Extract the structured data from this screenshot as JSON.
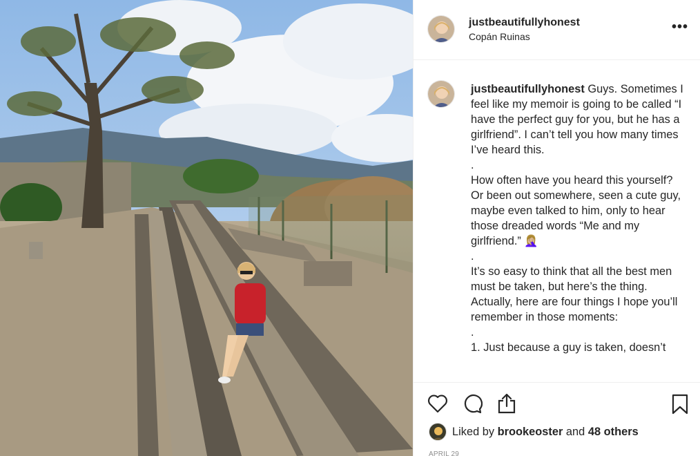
{
  "post": {
    "username": "justbeautifullyhonest",
    "location": "Copán Ruinas",
    "more_label": "•••"
  },
  "caption": {
    "username": "justbeautifullyhonest",
    "text": " Guys. Sometimes I feel like my memoir is going to be called “I have the perfect guy for you, but he has a girlfriend”. I can’t tell you how many times I’ve heard this.\n.\nHow often have you heard this yourself? Or been out somewhere, seen a cute guy, maybe even talked to him, only to hear those dreaded words “Me and my girlfriend.” 🤦🏼‍♀️\n.\nIt’s so easy to think that all the best men must be taken, but here’s the thing. Actually, here are four things I hope you’ll remember in those moments:\n.\n1. Just because a guy is taken, doesn’t"
  },
  "likes": {
    "prefix": "Liked by",
    "user": "brookeoster",
    "middle": "and",
    "others": "48 others"
  },
  "date": "APRIL 29",
  "icons": {
    "like": "heart-icon",
    "comment": "comment-icon",
    "share": "share-icon",
    "save": "bookmark-icon",
    "more": "more-options-icon"
  },
  "colors": {
    "text": "#262626",
    "secondary": "#8e8e8e",
    "border": "#efefef"
  }
}
